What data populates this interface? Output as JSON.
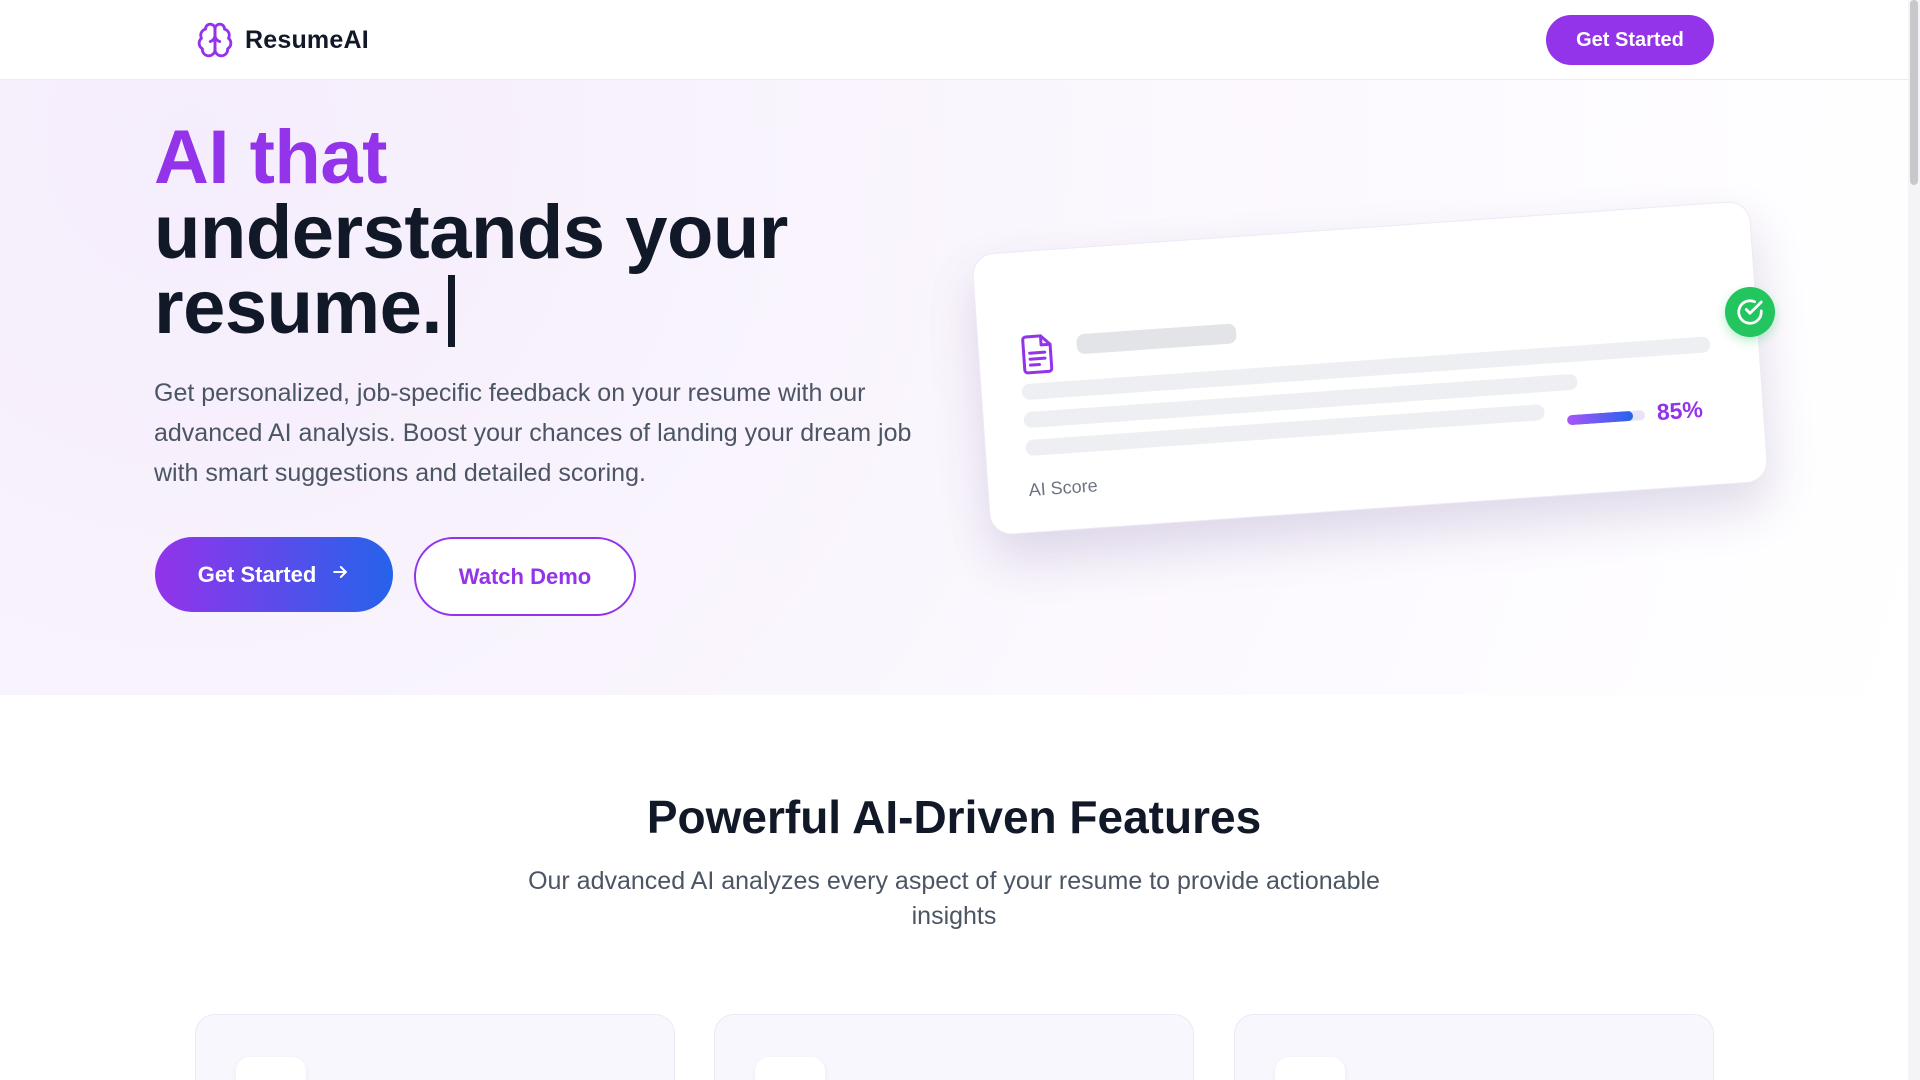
{
  "header": {
    "brand": "ResumeAI",
    "cta_label": "Get Started"
  },
  "hero": {
    "title_accent": "AI that",
    "title_rest_line1": "understands your",
    "title_rest_line2": "resume.",
    "description": "Get personalized, job-specific feedback on your resume with our advanced AI analysis. Boost your chances of landing your dream job with smart suggestions and detailed scoring.",
    "primary_button": "Get Started",
    "secondary_button": "Watch Demo"
  },
  "preview_card": {
    "score_label": "AI Score",
    "score_value": "85%",
    "score_fraction": 0.85
  },
  "features": {
    "title": "Powerful AI-Driven Features",
    "subtitle": "Our advanced AI analyzes every aspect of your resume to provide actionable insights"
  },
  "colors": {
    "brand": "#9333ea",
    "gradient_end": "#2563eb",
    "success": "#22c55e"
  },
  "icons": [
    "brain-icon",
    "arrow-right-icon",
    "document-icon",
    "check-circle-icon"
  ]
}
